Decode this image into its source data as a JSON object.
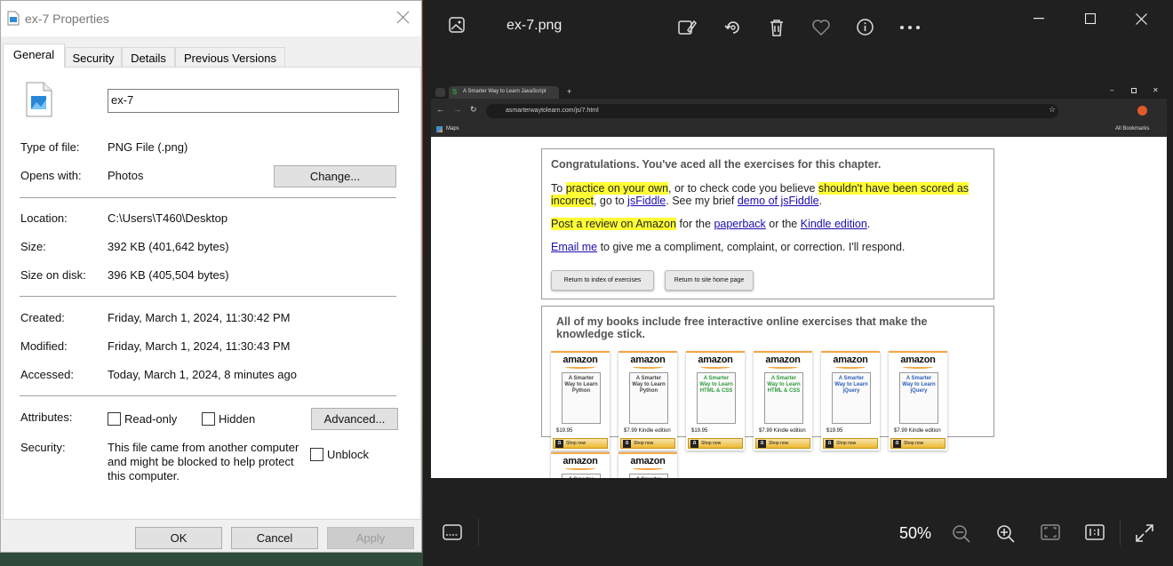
{
  "photos": {
    "filename": "ex-7.png",
    "zoom": "50%",
    "browser": {
      "tab_title": "A Smarter Way to Learn JavaScript",
      "url": "asmarterwaytolearn.com/js/7.html",
      "bookmark": "Maps",
      "all_bookmarks": "All Bookmarks",
      "page": {
        "heading": "Congratulations. You've aced all the exercises for this chapter.",
        "p1_a": "To ",
        "p1_h1": "practice on your own",
        "p1_b": ", or to check code you believe ",
        "p1_h2": "shouldn't have been scored as incorrect",
        "p1_c": ", go to ",
        "p1_l1": "jsFiddle",
        "p1_d": ". See my brief ",
        "p1_l2": "demo of jsFiddle",
        "p1_e": ".",
        "p2_h": "Post a review on Amazon",
        "p2_a": " for the ",
        "p2_l1": "paperback",
        "p2_b": " or the ",
        "p2_l2": "Kindle edition",
        "p2_c": ".",
        "p3_l": "Email me",
        "p3_a": " to give me a compliment, complaint, or correction. I'll respond.",
        "btn1": "Return to index of exercises",
        "btn2": "Return to site home page",
        "books_heading": "All of my books include free interactive online exercises that make the knowledge stick.",
        "books": [
          {
            "brand": "amazon",
            "title": "A Smarter Way to Learn Python",
            "price": "$19.95",
            "shop": "Shop now"
          },
          {
            "brand": "amazon",
            "title": "A Smarter Way to Learn Python",
            "price": "$7.99 Kindle edition",
            "shop": "Shop now"
          },
          {
            "brand": "amazon",
            "title": "A Smarter Way to Learn HTML & CSS",
            "price": "$19.95",
            "shop": "Shop now"
          },
          {
            "brand": "amazon",
            "title": "A Smarter Way to Learn HTML & CSS",
            "price": "$7.99 Kindle edition",
            "shop": "Shop now"
          },
          {
            "brand": "amazon",
            "title": "A Smarter Way to Learn jQuery",
            "price": "$19.95",
            "shop": "Shop now"
          },
          {
            "brand": "amazon",
            "title": "A Smarter Way to Learn jQuery",
            "price": "$7.99 Kindle edition",
            "shop": "Shop now"
          },
          {
            "brand": "amazon",
            "title": "A Smarter",
            "price": "",
            "shop": ""
          },
          {
            "brand": "amazon",
            "title": "A Smarter",
            "price": "",
            "shop": ""
          }
        ]
      }
    }
  },
  "props": {
    "title": "ex-7 Properties",
    "tabs": [
      "General",
      "Security",
      "Details",
      "Previous Versions"
    ],
    "name_value": "ex-7",
    "type_label": "Type of file:",
    "type_value": "PNG File (.png)",
    "opens_label": "Opens with:",
    "opens_value": "Photos",
    "change_btn": "Change...",
    "location_label": "Location:",
    "location_value": "C:\\Users\\T460\\Desktop",
    "size_label": "Size:",
    "size_value": "392 KB (401,642 bytes)",
    "disk_label": "Size on disk:",
    "disk_value": "396 KB (405,504 bytes)",
    "created_label": "Created:",
    "created_value": "Friday, March 1, 2024, 11:30:42 PM",
    "modified_label": "Modified:",
    "modified_value": "Friday, March 1, 2024, 11:30:43 PM",
    "accessed_label": "Accessed:",
    "accessed_value": "Today, March 1, 2024, 8 minutes ago",
    "attributes_label": "Attributes:",
    "readonly_label": "Read-only",
    "hidden_label": "Hidden",
    "advanced_btn": "Advanced...",
    "security_label": "Security:",
    "security_text": "This file came from another computer and might be blocked to help protect this computer.",
    "unblock_label": "Unblock",
    "ok_btn": "OK",
    "cancel_btn": "Cancel",
    "apply_btn": "Apply"
  }
}
